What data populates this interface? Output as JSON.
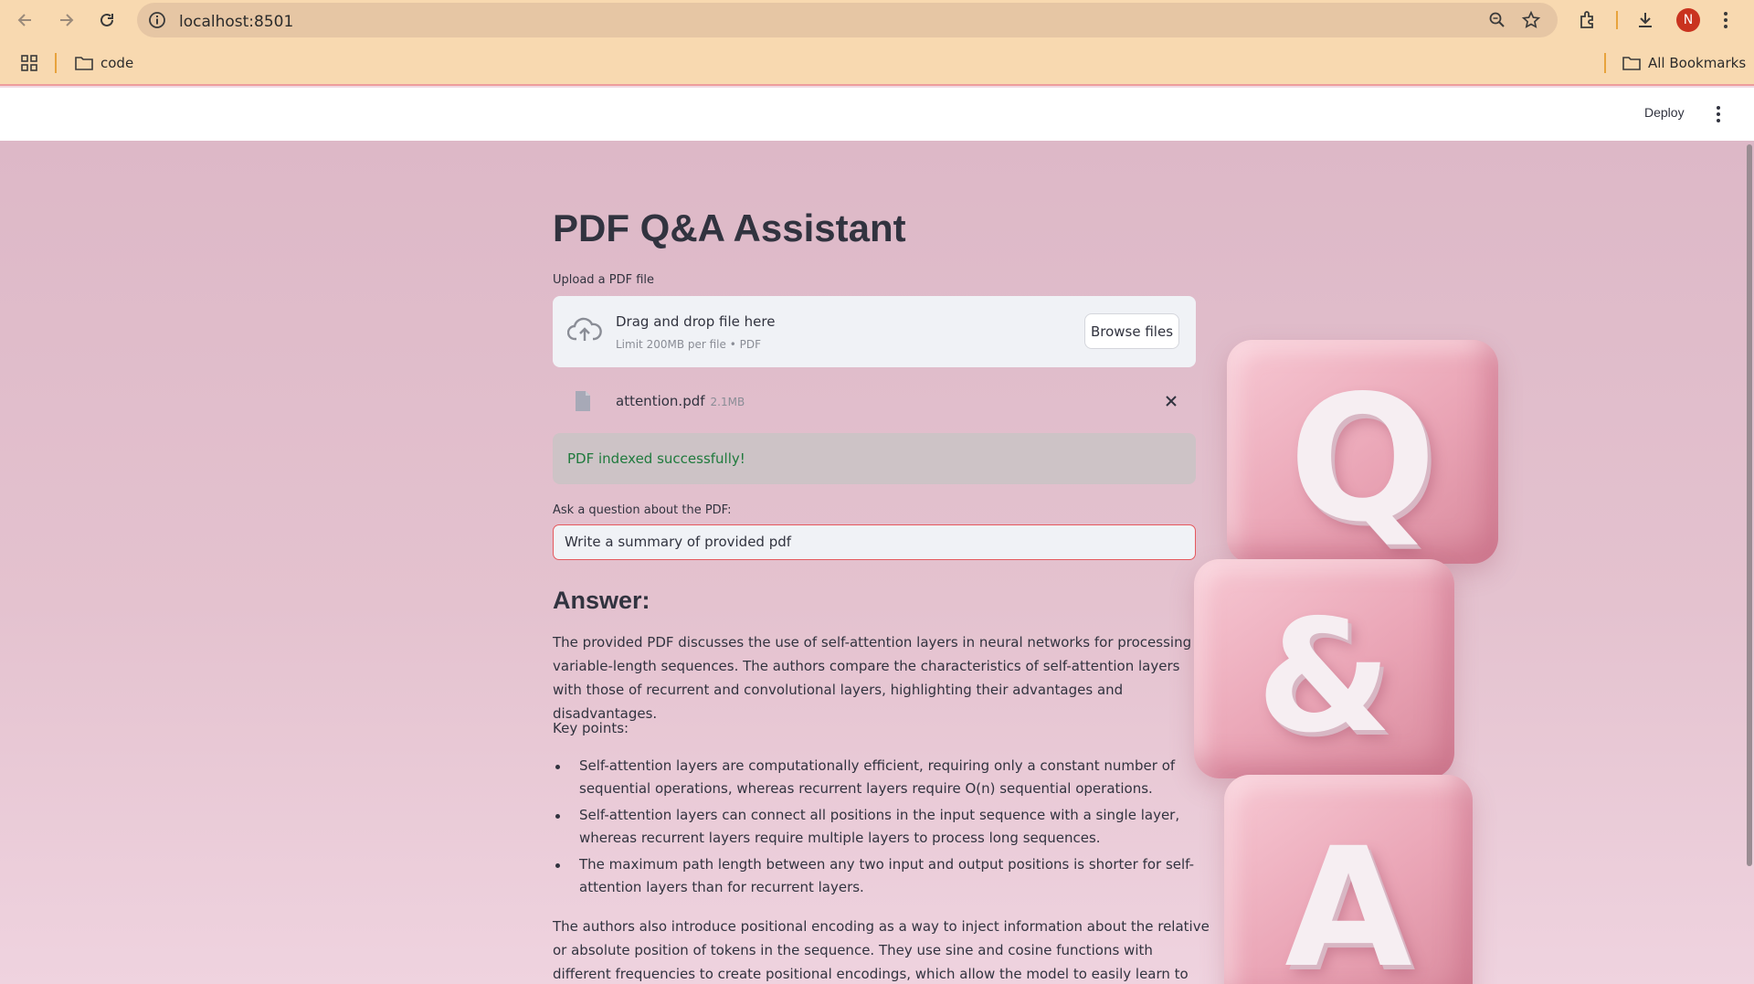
{
  "browser": {
    "url": "localhost:8501",
    "avatar_initial": "N",
    "bookmarks": [
      {
        "label": "code"
      }
    ],
    "all_bookmarks_label": "All Bookmarks"
  },
  "app_header": {
    "deploy_label": "Deploy"
  },
  "main": {
    "title": "PDF Q&A Assistant",
    "upload": {
      "label": "Upload a PDF file",
      "dropzone_text": "Drag and drop file here",
      "limit_text": "Limit 200MB per file • PDF",
      "browse_label": "Browse files",
      "file_name": "attention.pdf",
      "file_size": "2.1MB"
    },
    "status_message": "PDF indexed successfully!",
    "question": {
      "label": "Ask a question about the PDF:",
      "value": "Write a summary of provided pdf"
    },
    "answer": {
      "heading": "Answer:",
      "intro": "The provided PDF discusses the use of self-attention layers in neural networks for processing variable-length sequences. The authors compare the characteristics of self-attention layers with those of recurrent and convolutional layers, highlighting their advantages and disadvantages.",
      "key_points_label": "Key points:",
      "key_points": [
        "Self-attention layers are computationally efficient, requiring only a constant number of sequential operations, whereas recurrent layers require O(n) sequential operations.",
        "Self-attention layers can connect all positions in the input sequence with a single layer, whereas recurrent layers require multiple layers to process long sequences.",
        "The maximum path length between any two input and output positions is shorter for self-attention layers than for recurrent layers."
      ],
      "closing": "The authors also introduce positional encoding as a way to inject information about the relative or absolute position of tokens in the sequence. They use sine and cosine functions with different frequencies to create positional encodings, which allow the model to easily learn to attend by relative positions."
    }
  },
  "decor": {
    "letters": [
      "Q",
      "&",
      "A"
    ]
  },
  "colors": {
    "accent_red": "#e5595e",
    "success_green": "#1f7a3d",
    "browser_bar": "#f8d9b0"
  }
}
